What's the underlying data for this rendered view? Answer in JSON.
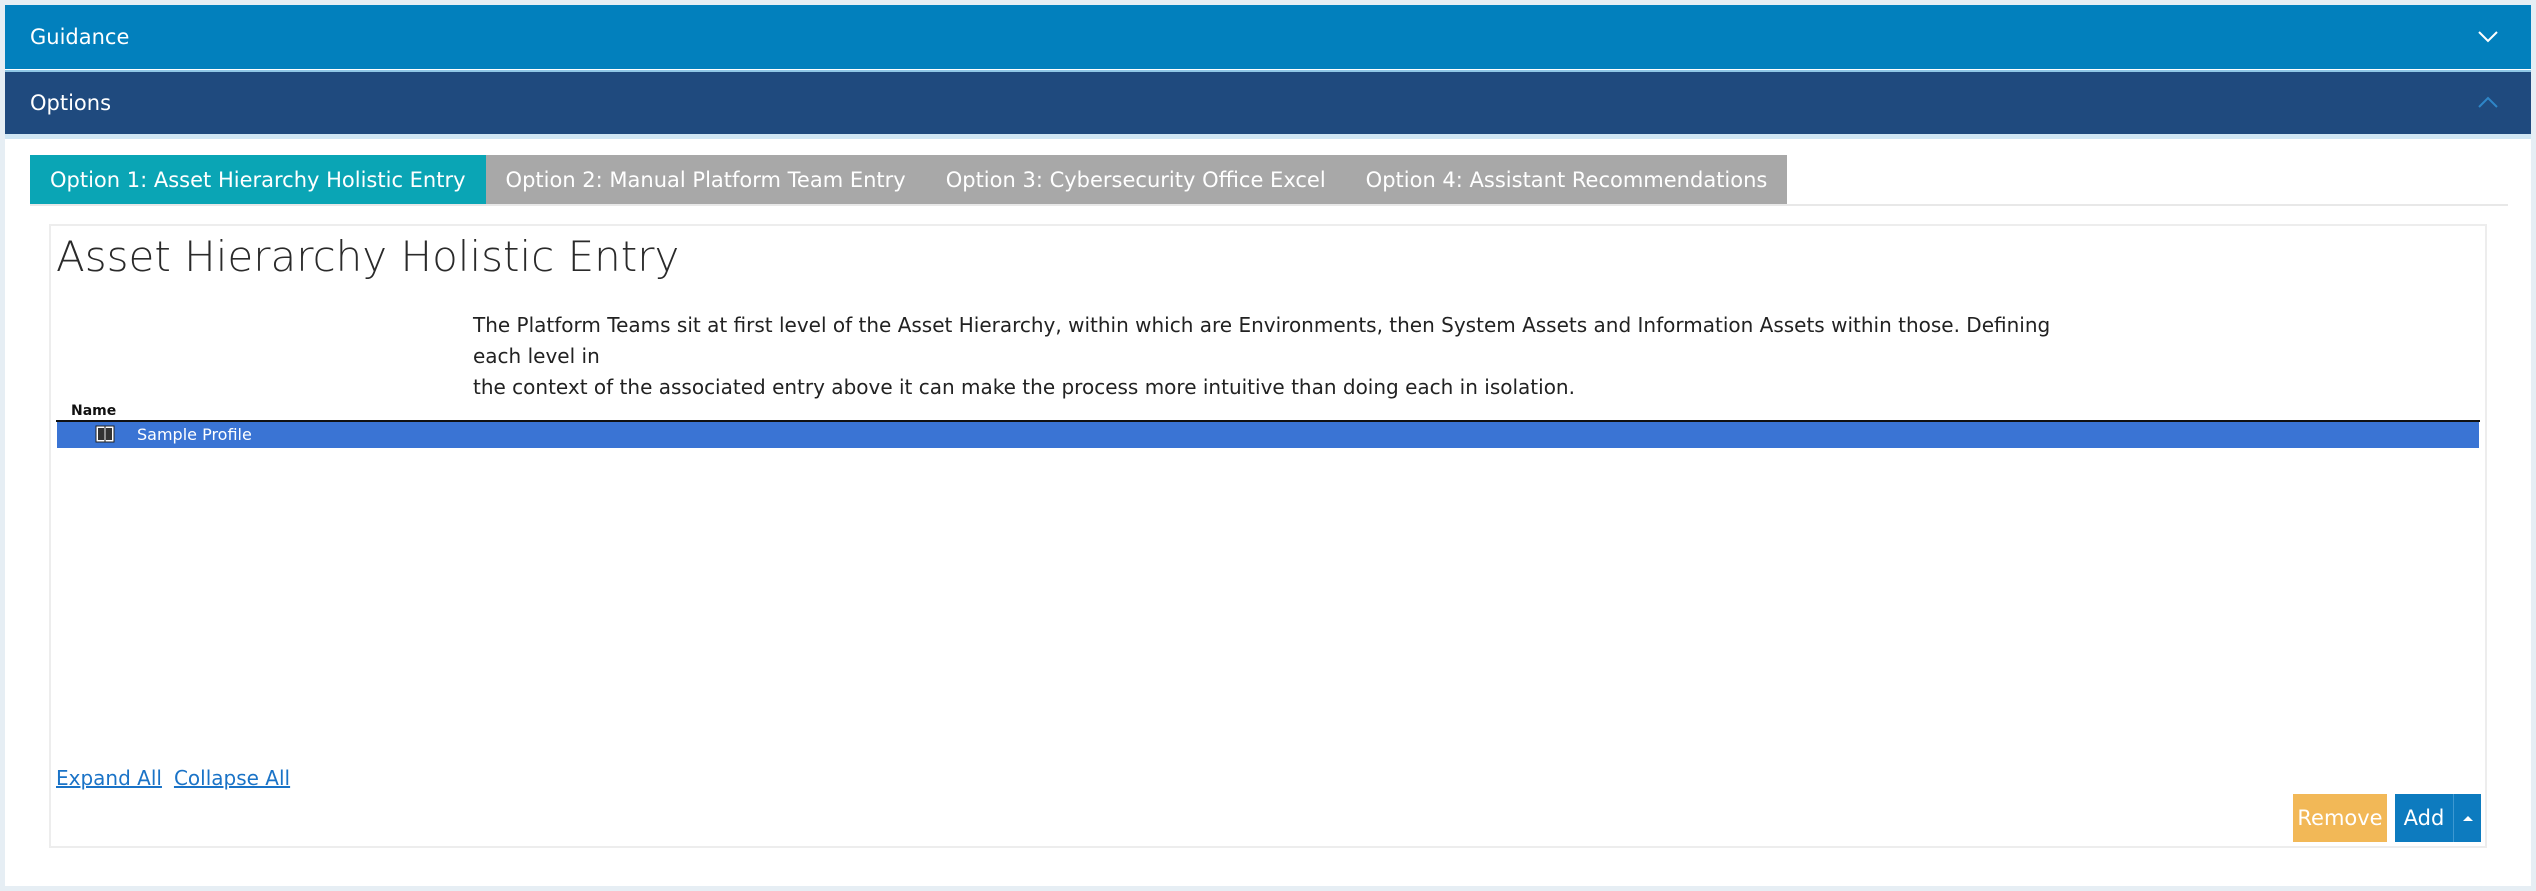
{
  "accordion": {
    "guidance_label": "Guidance",
    "options_label": "Options"
  },
  "tabs": [
    {
      "label": "Option 1: Asset Hierarchy Holistic Entry",
      "active": true
    },
    {
      "label": "Option 2: Manual Platform Team Entry",
      "active": false
    },
    {
      "label": "Option 3: Cybersecurity Office Excel",
      "active": false
    },
    {
      "label": "Option 4: Assistant Recommendations",
      "active": false
    }
  ],
  "panel": {
    "title": "Asset Hierarchy Holistic Entry",
    "description_line1": "The Platform Teams sit at first level of the Asset Hierarchy, within which are Environments, then System Assets and Information Assets within those. Defining each level in",
    "description_line2": "the context of the associated entry above it can make the process more intuitive than doing each in isolation."
  },
  "grid": {
    "column_header": "Name",
    "rows": [
      {
        "label": "Sample Profile",
        "icon": "profile-book-icon",
        "selected": true
      }
    ]
  },
  "links": {
    "expand_all": "Expand All",
    "collapse_all": "Collapse All"
  },
  "buttons": {
    "remove": "Remove",
    "add": "Add"
  },
  "colors": {
    "guidance_bar": "#0280bd",
    "options_bar": "#1f4a7e",
    "active_tab": "#0aa5b5",
    "inactive_tab": "#a8a8a8",
    "selected_row": "#3a74d4",
    "remove_button": "#f2b857",
    "add_button": "#0d7bbf"
  }
}
